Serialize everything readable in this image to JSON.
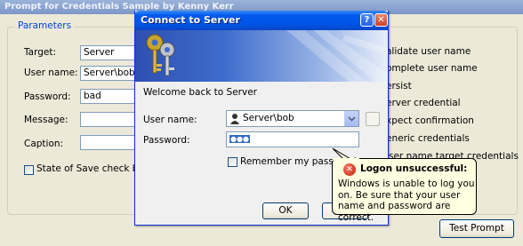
{
  "back_window": {
    "title": "Prompt for Credentials Sample by Kenny Kerr",
    "group_label": "Parameters",
    "fields": {
      "target_label": "Target:",
      "target_value": "Server",
      "username_label": "User name:",
      "username_value": "Server\\bob",
      "password_label": "Password:",
      "password_value": "bad",
      "message_label": "Message:",
      "message_value": "",
      "caption_label": "Caption:",
      "caption_value": ""
    },
    "save_state_label": "State of Save check box",
    "options": [
      "alidate user name",
      "omplete user name",
      "ersist",
      "erver credential",
      "xpect confirmation",
      "eneric credentials",
      "ser name target credentials"
    ],
    "test_button_label": "Test Prompt"
  },
  "dialog": {
    "title": "Connect to Server",
    "help_glyph": "?",
    "close_glyph": "✕",
    "welcome": "Welcome back to Server",
    "username_label": "User name:",
    "username_value": "Server\\bob",
    "password_label": "Password:",
    "password_mask": "●●●",
    "remember_label": "Remember my password",
    "ok_label": "OK",
    "icons": [
      "keys-icon",
      "user-icon",
      "dropdown-arrow-icon",
      "browse-icon"
    ]
  },
  "balloon": {
    "title": "Logon unsuccessful:",
    "message": "Windows is unable to log you on. Be sure that your user name and password are correct.",
    "icon": "error-icon",
    "icon_glyph": "✕"
  },
  "colors": {
    "title_blue": "#0055e5",
    "balloon_bg": "#ffffe1",
    "error_red": "#c8200c"
  }
}
